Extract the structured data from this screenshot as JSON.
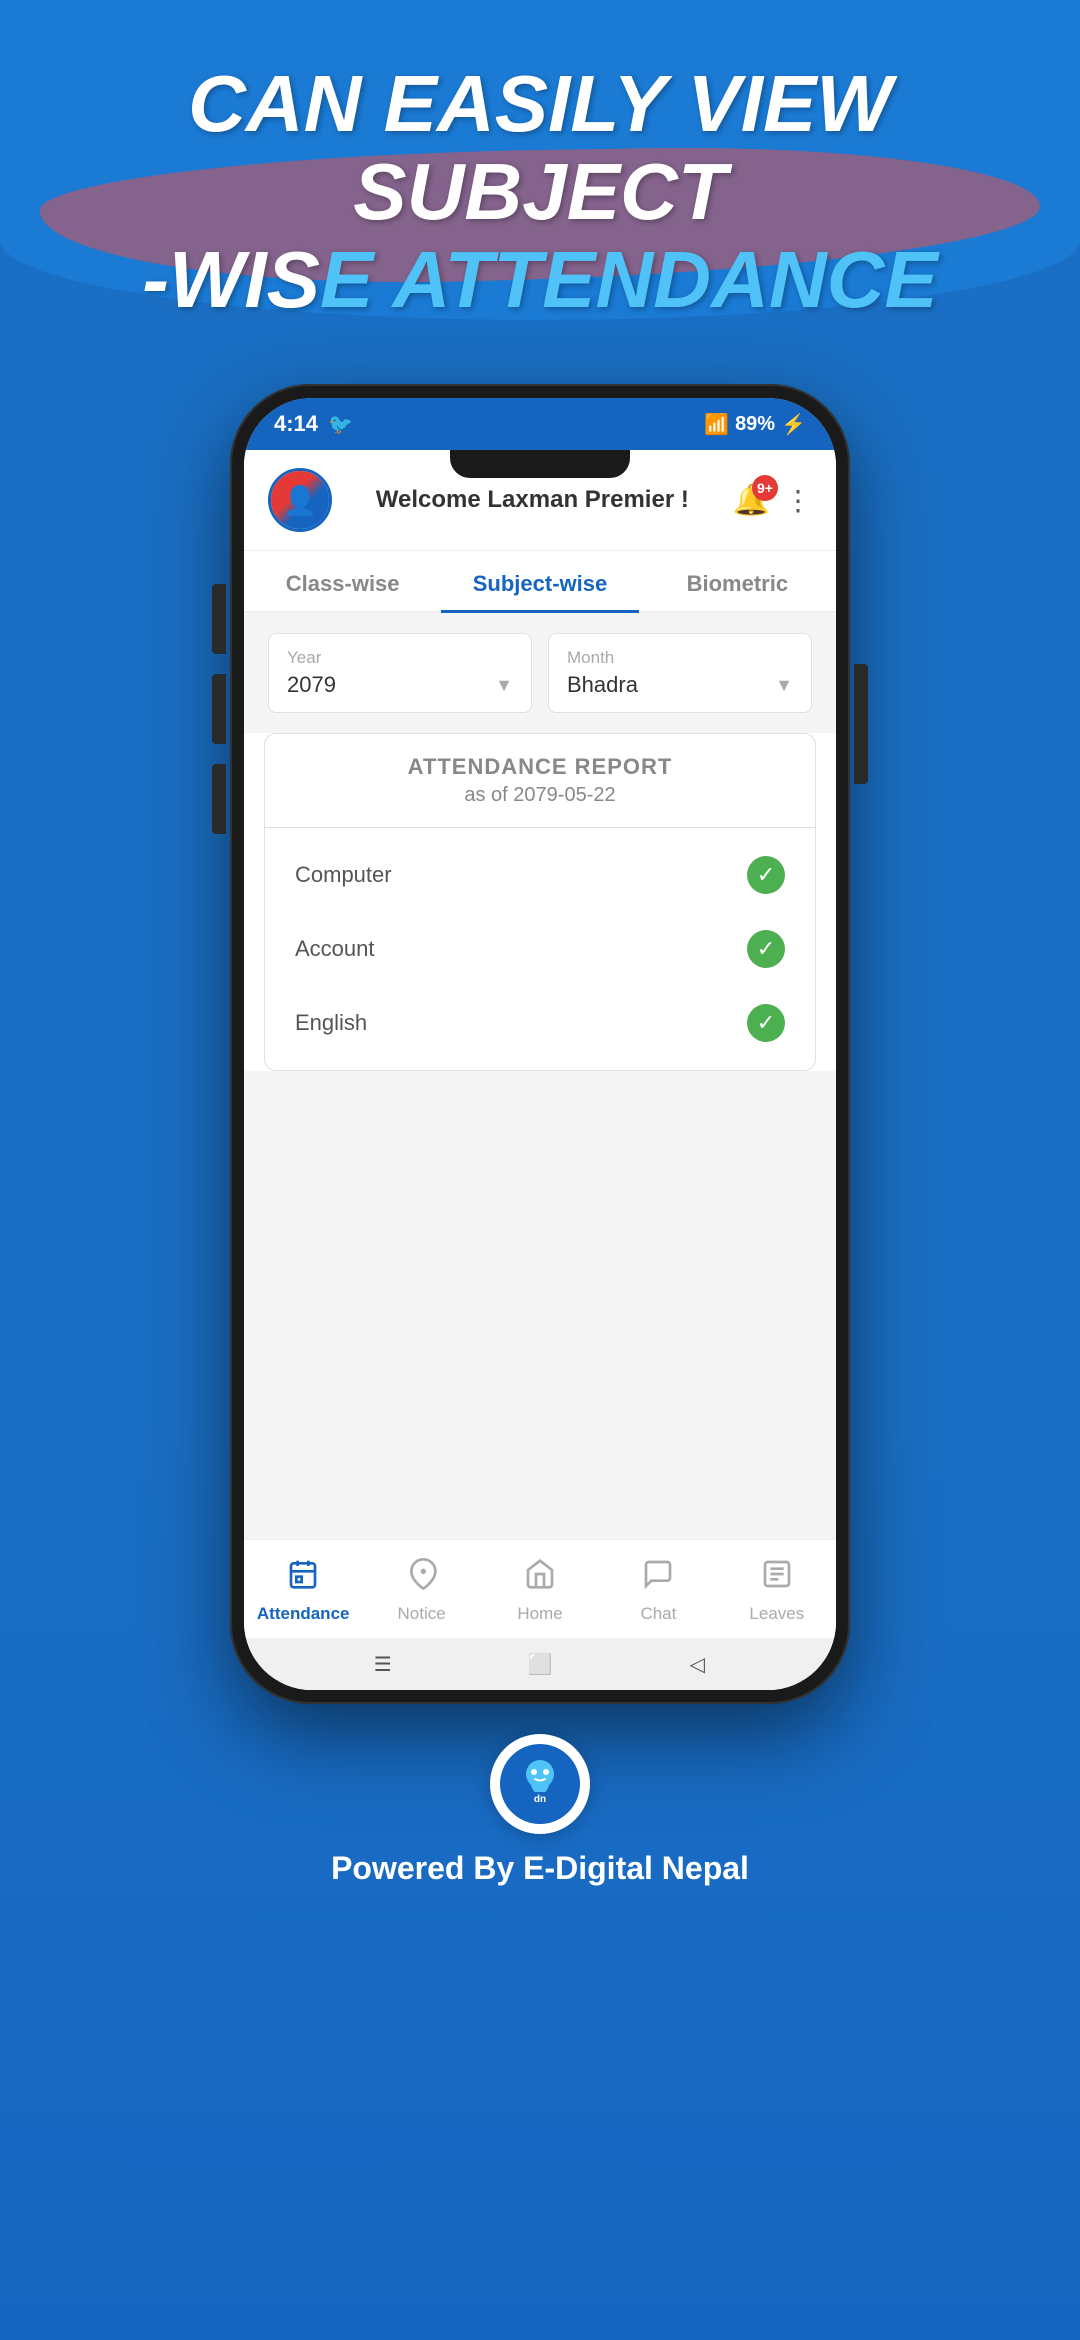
{
  "header": {
    "title_line1": "CAN EASILY VIEW SUBJECT",
    "title_line2": "-WISE ATTENDANCE"
  },
  "status_bar": {
    "time": "4:14",
    "battery": "89%",
    "signal": "▌▌▌"
  },
  "app": {
    "welcome_text": "Welcome Laxman Premier !",
    "notification_badge": "9+",
    "tabs": [
      {
        "id": "class-wise",
        "label": "Class-wise",
        "active": false
      },
      {
        "id": "subject-wise",
        "label": "Subject-wise",
        "active": true
      },
      {
        "id": "biometric",
        "label": "Biometric",
        "active": false
      }
    ],
    "year_label": "Year",
    "year_value": "2079",
    "month_label": "Month",
    "month_value": "Bhadra",
    "report": {
      "title": "ATTENDANCE REPORT",
      "date_prefix": "as of",
      "date": "2079-05-22",
      "subjects": [
        {
          "name": "Computer",
          "status": "present"
        },
        {
          "name": "Account",
          "status": "present"
        },
        {
          "name": "English",
          "status": "present"
        }
      ]
    },
    "bottom_nav": [
      {
        "id": "attendance",
        "label": "Attendance",
        "active": true,
        "icon": "📅"
      },
      {
        "id": "notice",
        "label": "Notice",
        "active": false,
        "icon": "📢"
      },
      {
        "id": "home",
        "label": "Home",
        "active": false,
        "icon": "🏠"
      },
      {
        "id": "chat",
        "label": "Chat",
        "active": false,
        "icon": "💬"
      },
      {
        "id": "leaves",
        "label": "Leaves",
        "active": false,
        "icon": "📋"
      }
    ]
  },
  "footer": {
    "powered_by": "Powered By E-Digital Nepal",
    "logo_text": "dn"
  }
}
